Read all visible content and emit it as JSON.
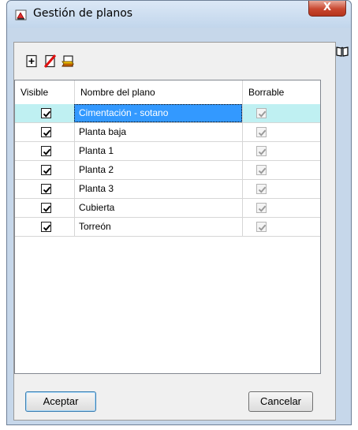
{
  "window": {
    "title": "Gestión de planos",
    "close_label": "X"
  },
  "toolbar": {
    "buttons": [
      {
        "icon": "add-plan-icon"
      },
      {
        "icon": "delete-plan-icon"
      },
      {
        "icon": "edit-plan-icon"
      }
    ]
  },
  "side_icon": "book-help-icon",
  "table": {
    "columns": [
      "Visible",
      "Nombre del plano",
      "Borrable"
    ],
    "rows": [
      {
        "visible": true,
        "name": "Cimentación - sotano",
        "borrable": true,
        "selected": true
      },
      {
        "visible": true,
        "name": "Planta baja",
        "borrable": true,
        "selected": false
      },
      {
        "visible": true,
        "name": "Planta 1",
        "borrable": true,
        "selected": false
      },
      {
        "visible": true,
        "name": "Planta 2",
        "borrable": true,
        "selected": false
      },
      {
        "visible": true,
        "name": "Planta 3",
        "borrable": true,
        "selected": false
      },
      {
        "visible": true,
        "name": "Cubierta",
        "borrable": true,
        "selected": false
      },
      {
        "visible": true,
        "name": "Torreón",
        "borrable": true,
        "selected": false
      }
    ]
  },
  "buttons": {
    "accept": "Aceptar",
    "cancel": "Cancelar"
  }
}
